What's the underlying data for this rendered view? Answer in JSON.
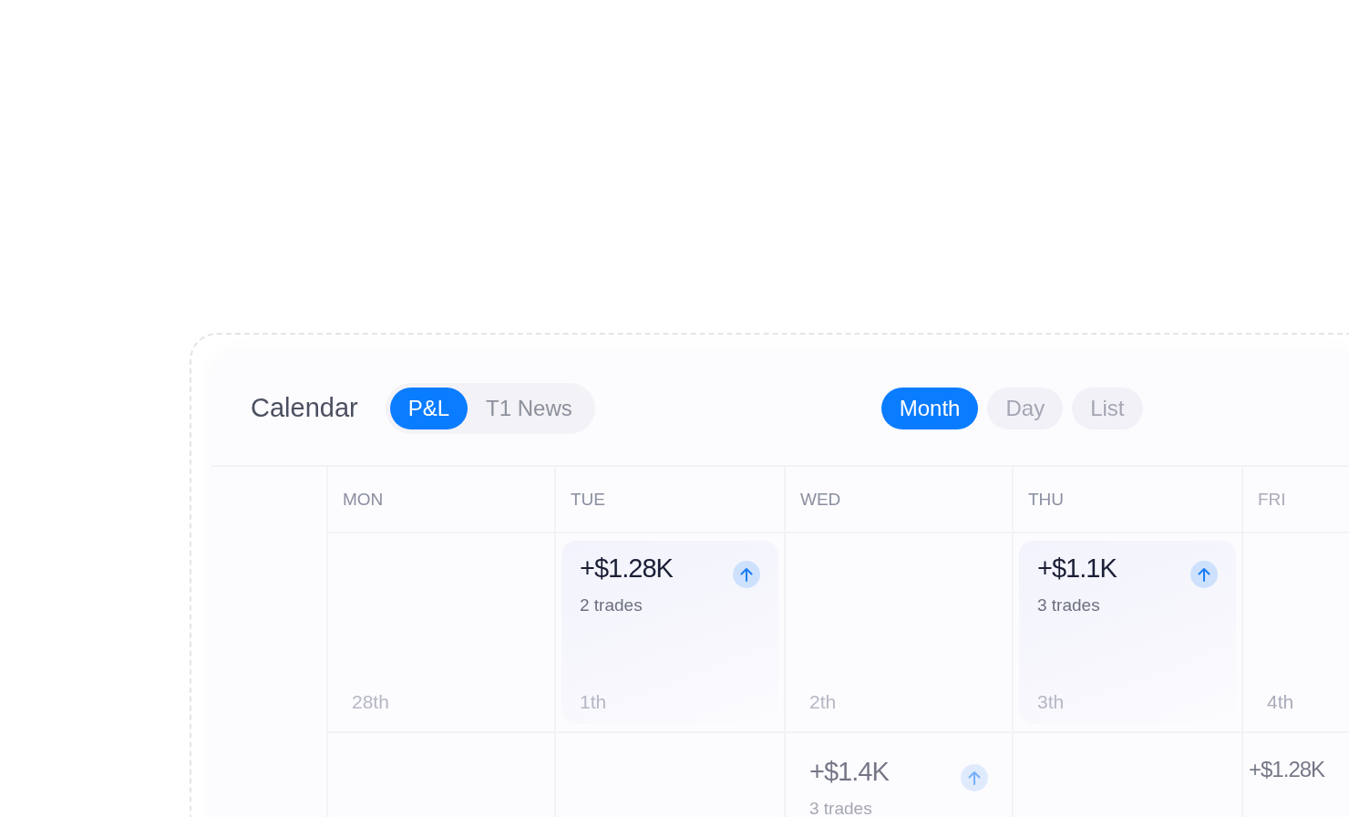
{
  "title": "Calendar",
  "tabs": [
    {
      "label": "P&L",
      "selected": true
    },
    {
      "label": "T1 News",
      "selected": false
    }
  ],
  "views": [
    {
      "label": "Month",
      "selected": true
    },
    {
      "label": "Day",
      "selected": false
    },
    {
      "label": "List",
      "selected": false
    }
  ],
  "days": [
    "MON",
    "TUE",
    "WED",
    "THU",
    "FRI"
  ],
  "weeks": [
    {
      "mon": {
        "date": "28th"
      },
      "tue": {
        "date": "1th",
        "event": {
          "amount": "+$1.28K",
          "trades": "2 trades",
          "arrow": true
        }
      },
      "wed": {
        "date": "2th"
      },
      "thu": {
        "date": "3th",
        "event": {
          "amount": "+$1.1K",
          "trades": "3 trades",
          "arrow": true
        }
      },
      "fri": {
        "date": "4th"
      }
    },
    {
      "wed": {
        "event": {
          "amount": "+$1.4K",
          "trades": "3 trades",
          "arrow": true
        }
      },
      "fri": {
        "event": {
          "amount": "+$1.28K",
          "arrow": false
        }
      }
    }
  ]
}
